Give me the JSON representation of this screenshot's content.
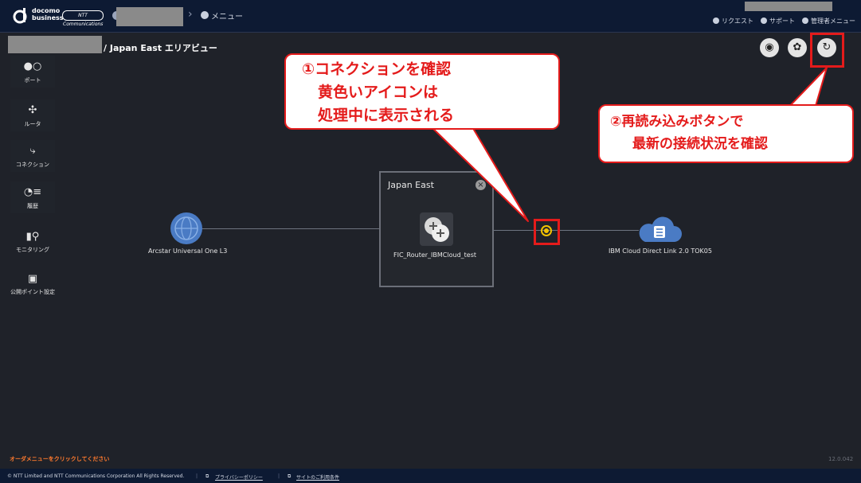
{
  "header": {
    "logo_line1": "docomo",
    "logo_line2": "business",
    "ntt_logo": "NTT Communications",
    "menu_label": "メニュー",
    "nav": {
      "request": "リクエスト",
      "support": "サポート",
      "admin_menu": "管理者メニュー"
    }
  },
  "sidebar": {
    "items": [
      {
        "label": "ポート",
        "icon": "port-icon"
      },
      {
        "label": "ルータ",
        "icon": "router-icon"
      },
      {
        "label": "コネクション",
        "icon": "connection-icon"
      },
      {
        "label": "履歴",
        "icon": "history-icon"
      },
      {
        "label": "モニタリング",
        "icon": "monitoring-icon"
      },
      {
        "label": "公開ポイント設定",
        "icon": "monitor-icon"
      }
    ]
  },
  "page": {
    "title": "/ Japan East エリアビュー"
  },
  "diagram": {
    "left_node": "Arcstar Universal One L3",
    "area_name": "Japan East",
    "router_name": "FIC_Router_IBMCloud_test",
    "right_node": "IBM Cloud Direct Link 2.0 TOK05"
  },
  "callouts": {
    "one": [
      "①コネクションを確認",
      "黄色いアイコンは",
      "処理中に表示される"
    ],
    "two": [
      "②再読み込みボタンで",
      "最新の接続状況を確認"
    ]
  },
  "status": {
    "order_message": "オーダメニューをクリックしてください",
    "version": "12.0.042"
  },
  "footer": {
    "copyright": "© NTT Limited and NTT Communications Corporation All Rights Reserved.",
    "privacy": "プライバシーポリシー",
    "terms": "サイトのご利用条件"
  },
  "colors": {
    "accent_red": "#e41b1b",
    "processing_yellow": "#f2c300",
    "header_bg": "#0d1a33"
  }
}
